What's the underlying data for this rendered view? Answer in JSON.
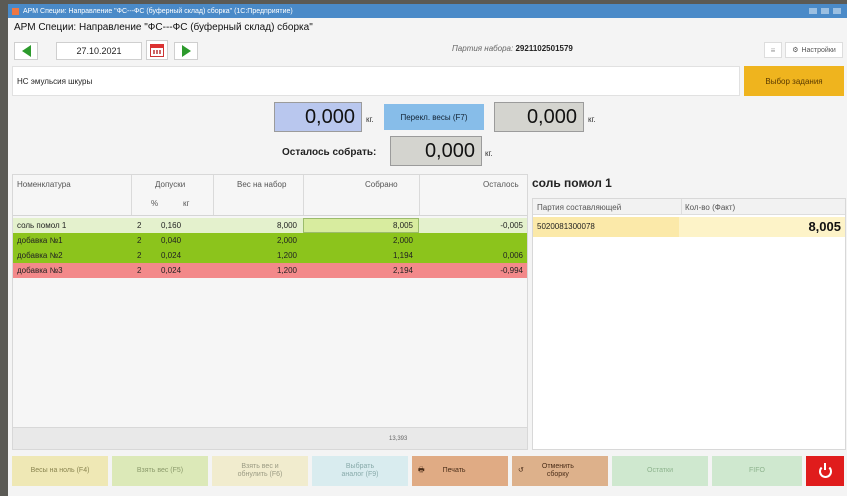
{
  "window": {
    "title": "АРМ Специи: Направление \"ФС---ФС (буферный склад) сборка\" (1С:Предприятие)"
  },
  "app": {
    "title": "АРМ Специи: Направление \"ФС---ФС (буферный склад) сборка\""
  },
  "toolbar": {
    "date": "27.10.2021",
    "batch_label": "Партия набора:",
    "batch_value": "2921102501579",
    "settings_label": "Настройки"
  },
  "task": {
    "name": "НС эмульсия шкуры",
    "select_button": "Выбор задания"
  },
  "weights": {
    "scale1": "0,000",
    "scale2": "0,000",
    "remaining": "0,000",
    "unit": "кг.",
    "switch_button": "Перекл. весы (F7)",
    "remaining_label": "Осталось собрать:"
  },
  "grid": {
    "headers": {
      "name": "Номенклатура",
      "tolerance": "Допуски",
      "tol_pct": "%",
      "tol_kg": "кг",
      "target": "Вес на набор",
      "collected": "Собрано",
      "remain": "Осталось"
    },
    "rows": [
      {
        "name": "соль помол 1",
        "pct": "2",
        "kg": "0,160",
        "target": "8,000",
        "collected": "8,005",
        "remain": "-0,005"
      },
      {
        "name": "добавка №1",
        "pct": "2",
        "kg": "0,040",
        "target": "2,000",
        "collected": "2,000",
        "remain": ""
      },
      {
        "name": "добавка №2",
        "pct": "2",
        "kg": "0,024",
        "target": "1,200",
        "collected": "1,194",
        "remain": "0,006"
      },
      {
        "name": "добавка №3",
        "pct": "2",
        "kg": "0,024",
        "target": "1,200",
        "collected": "2,194",
        "remain": "-0,994"
      }
    ],
    "total": "13,393"
  },
  "side": {
    "title": "соль помол 1",
    "headers": {
      "batch": "Партия составляющей",
      "qty": "Кол-во (Факт)"
    },
    "row": {
      "batch": "5020081300078",
      "qty": "8,005"
    }
  },
  "buttons": {
    "zero": "Весы на ноль (F4)",
    "take": "Взять вес (F5)",
    "take_reset_1": "Взять вес и",
    "take_reset_2": "обнулить (F6)",
    "analog_1": "Выбрать",
    "analog_2": "аналог (F9)",
    "print": "Печать",
    "cancel_1": "Отменить",
    "cancel_2": "сборку",
    "rest": "Остатки",
    "fifo": "FIFO"
  },
  "colors": {
    "row_selected": "#e4f1cd",
    "row_green": "#8cc41c",
    "row_red": "#f3898a",
    "collected_highlight": "#d8ec9f",
    "accent_yellow": "#efb41e",
    "power_red": "#e01c1c"
  }
}
